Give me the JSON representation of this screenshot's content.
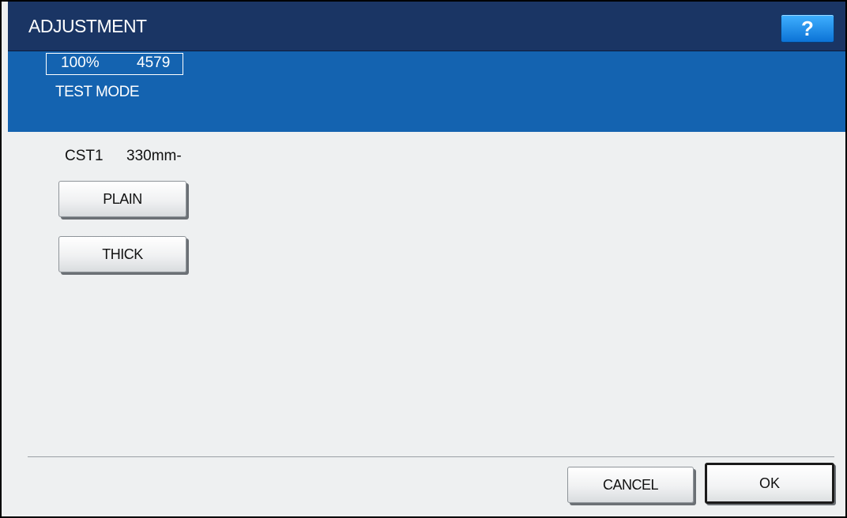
{
  "header": {
    "title": "ADJUSTMENT",
    "help_label": "?"
  },
  "status": {
    "zoom": "100%",
    "count": "4579",
    "mode": "TEST MODE"
  },
  "cassette": {
    "name": "CST1",
    "size": "330mm-"
  },
  "paper_types": {
    "plain_label": "PLAIN",
    "thick_label": "THICK"
  },
  "footer": {
    "cancel_label": "CANCEL",
    "ok_label": "OK"
  },
  "colors": {
    "titlebar": "#1a3564",
    "status_band": "#1463b0",
    "help_button": "#1d8ff0",
    "panel_background": "#eef0f1"
  }
}
